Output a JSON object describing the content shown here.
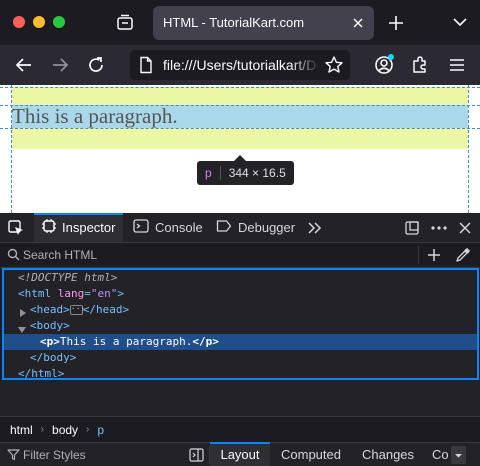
{
  "browser": {
    "tab": {
      "title": "HTML - TutorialKart.com"
    },
    "url": "file:///Users/tutorialkart/D"
  },
  "page": {
    "paragraph": "This is a paragraph.",
    "infobar": {
      "tag": "p",
      "dimensions": "344 × 16.5"
    },
    "colors": {
      "padding": "#ebf7a5",
      "content": "#a9d8ea"
    }
  },
  "devtools": {
    "tabs": [
      {
        "label": "Inspector",
        "selected": true
      },
      {
        "label": "Console"
      },
      {
        "label": "Debugger"
      }
    ],
    "search": {
      "placeholder": "Search HTML"
    },
    "markup": {
      "doctype": "<!DOCTYPE html>",
      "html_open": "<html",
      "lang_attr": "lang",
      "lang_val": "\"en\"",
      "head_open": "<head>",
      "head_close": "</head>",
      "body_open": "<body>",
      "p_open": "<p>",
      "p_text": "This is a paragraph.",
      "p_close": "</p>",
      "body_close": "</body>",
      "html_close": "</html>"
    },
    "breadcrumbs": [
      {
        "label": "html"
      },
      {
        "label": "body"
      },
      {
        "label": "p",
        "selected": true
      }
    ],
    "filter": {
      "placeholder": "Filter Styles"
    },
    "side_tabs": [
      {
        "label": "Layout",
        "selected": true
      },
      {
        "label": "Computed"
      },
      {
        "label": "Changes"
      },
      {
        "label": "Co"
      }
    ]
  }
}
